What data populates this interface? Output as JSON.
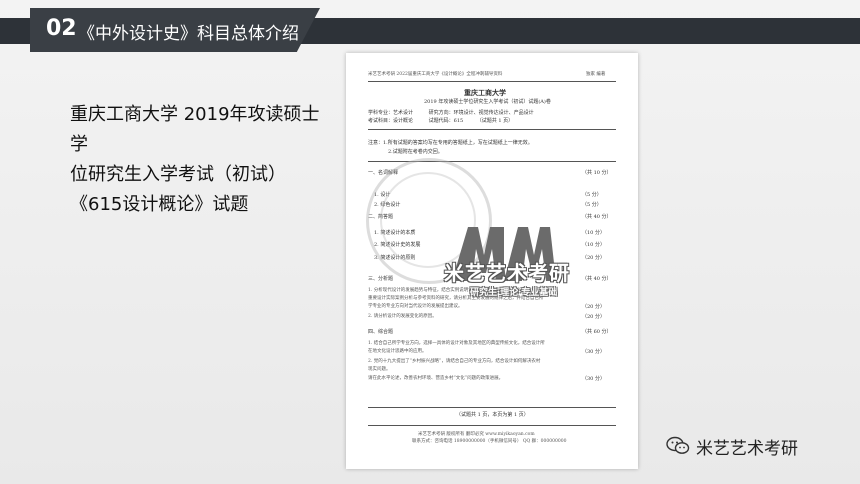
{
  "header": {
    "number": "02",
    "title": "《中外设计史》科目总体介绍"
  },
  "intro": {
    "line1": "重庆工商大学 2019年攻读硕士学",
    "line2": "位研究生入学考试（初试）",
    "line3": "《615设计概论》试题"
  },
  "exam": {
    "top_left": "米艺艺术考研 2022届重庆工商大学《设计概论》全程冲刺辅导资料",
    "top_right": "独家 编著",
    "university": "重庆工商大学",
    "subtitle": "2019 年攻读硕士学位研究生入学考试（初试）试题(A)卷",
    "meta": [
      {
        "label": "学科专业：",
        "value": "艺术设计",
        "label2": "研究方向：",
        "value2": "环境设计、视觉传达设计、产品设计"
      },
      {
        "label": "考试科目：",
        "value": "设计概论",
        "label2": "试题代码：",
        "value2": "615",
        "extra": "（试题共 1 页）"
      }
    ],
    "notes": [
      "注意：1.所有试题的答案均写在专用的答题纸上，写在试题纸上一律无效。",
      "2.试题附在考卷内交回。"
    ],
    "sections": [
      {
        "heading": "一、名词解释",
        "score": "（共 10 分）",
        "items": [
          {
            "text": "1. 设计",
            "score": "（5 分）"
          },
          {
            "text": "2. 绿色设计",
            "score": "（5 分）"
          }
        ]
      },
      {
        "heading": "二、简答题",
        "score": "（共 40 分）",
        "items": [
          {
            "text": "1. 简述设计的本质",
            "score": "（10 分）"
          },
          {
            "text": "2. 简述设计史的发展",
            "score": "（10 分）"
          },
          {
            "text": "3. 简述设计的原则",
            "score": "（20 分）"
          }
        ]
      },
      {
        "heading": "三、分析题",
        "score": "（共 40 分）",
        "paras": [
          "1. 分析现代设计的发展趋势与特征，结合实例说明设计对社会的影响，论述设计与用户。",
          "重要设计实际案例分析与参考资料的研究，请分析其主要发展的规律之后，并结合自己所",
          "学专业的专业方向对当代设计的发展提出建议。",
          "2. 请分析设计的发展变化的原因。"
        ],
        "para_scores": [
          "（20 分）",
          "（20 分）"
        ]
      },
      {
        "heading": "四、综合题",
        "score": "（共 60 分）",
        "paras": [
          "1. 结合自己所学专业方向，选择一具体的设计对象及其地区的典型传统文化，结合设计所",
          "在地文化设计思路中的应用。",
          "2. 党的十九大提出了“乡村振兴战略”，请结合自己的专业方向，结合设计如何解决农村",
          "现实问题。",
          "请在此水平论述，改善农村环境、营造乡村“文化”问题的政策进展。"
        ],
        "para_scores": [
          "（30 分）",
          "（30 分）"
        ]
      }
    ],
    "footer": "（试题共 1 页，本页为第 1 页）",
    "bottom_lines": [
      "米艺艺术考研 版权所有 翻印必究 www.miyikaoyan.com",
      "联系方式：咨询电话 18900000000（手机微信同号） QQ 群：000000000"
    ],
    "watermark_name": "米艺艺术考研",
    "watermark_slogan": "研究生·理论·专业基础"
  },
  "brand": {
    "name": "米艺艺术考研",
    "icon": "wechat-icon"
  },
  "colors": {
    "header": "#2d3238",
    "tab": "#3a3f45",
    "background": "#eeeeee"
  }
}
